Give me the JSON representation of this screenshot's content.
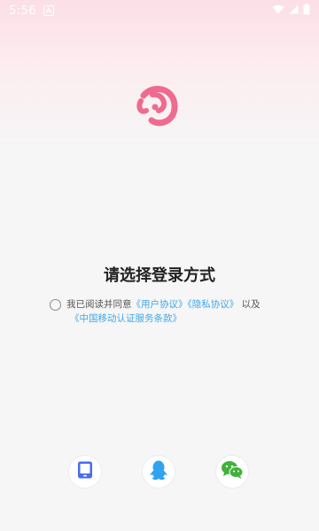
{
  "status_bar": {
    "time": "5:56",
    "icons": [
      "notification-a-icon",
      "wifi-icon",
      "signal-icon",
      "battery-icon"
    ]
  },
  "app": {
    "logo_icon": "app-logo-icon",
    "logo_color": "#ee6b8f"
  },
  "login": {
    "title": "请选择登录方式",
    "agreement": {
      "prefix": "我已阅读并同意",
      "user_agreement": "《用户协议》",
      "privacy_agreement": "《隐私协议》",
      "conjunction": "以及",
      "cmcc_terms": "《中国移动认证服务条款》",
      "link_color": "#3fa6e6"
    },
    "options": [
      {
        "name": "phone-login",
        "icon": "phone-icon",
        "color": "#4a6cf0"
      },
      {
        "name": "qq-login",
        "icon": "qq-penguin-icon",
        "color": "#2fa3f0"
      },
      {
        "name": "wechat-login",
        "icon": "wechat-icon",
        "color": "#3fb23a"
      }
    ]
  }
}
